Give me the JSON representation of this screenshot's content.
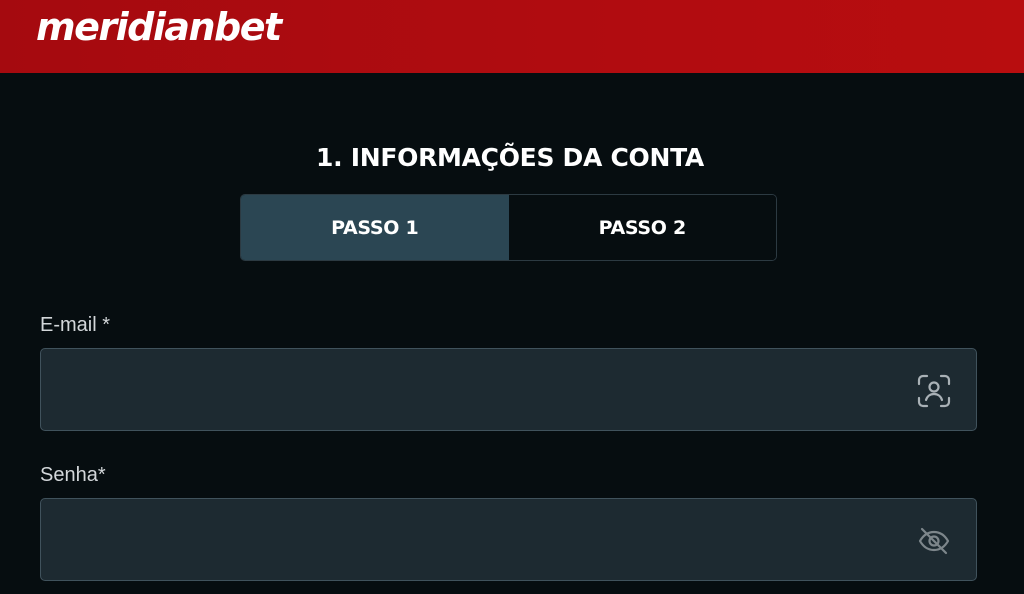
{
  "header": {
    "logo_text": "meridianbet"
  },
  "form": {
    "section_title": "1. INFORMAÇÕES DA CONTA",
    "steps": [
      {
        "label": "PASSO 1",
        "active": true
      },
      {
        "label": "PASSO 2",
        "active": false
      }
    ],
    "email": {
      "label": "E-mail *",
      "value": "",
      "icon": "user-scan-icon"
    },
    "password": {
      "label": "Senha*",
      "value": "",
      "icon": "eye-off-icon"
    }
  },
  "colors": {
    "header_red": "#b00c10",
    "background": "#060d10",
    "active_step": "#2b4653",
    "input_bg": "#1d2a31"
  }
}
